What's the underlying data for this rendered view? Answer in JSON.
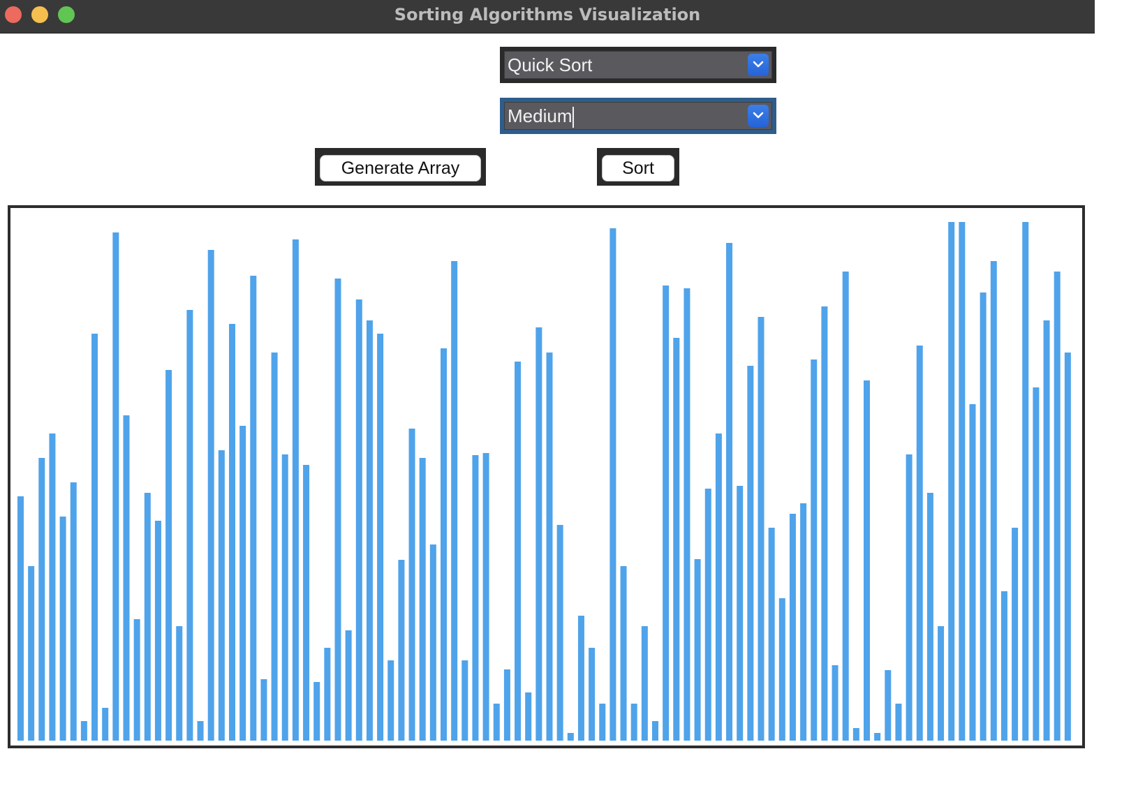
{
  "window": {
    "title": "Sorting Algorithms Visualization"
  },
  "controls": {
    "algorithm_select": {
      "value": "Quick Sort"
    },
    "speed_select": {
      "value": "Medium"
    },
    "generate_label": "Generate Array",
    "sort_label": "Sort"
  },
  "colors": {
    "bar": "#4fa3ea",
    "titlebar": "#3a3939",
    "select_button": "#2f6fe0"
  },
  "icons": [
    "close-icon",
    "minimize-icon",
    "zoom-icon",
    "chevron-down-icon"
  ],
  "chart_data": {
    "type": "bar",
    "description_values_are_relative_heights": true,
    "values": [
      350,
      250,
      405,
      440,
      321,
      370,
      28,
      583,
      47,
      728,
      466,
      174,
      355,
      315,
      531,
      164,
      617,
      28,
      703,
      416,
      597,
      451,
      666,
      88,
      556,
      410,
      718,
      395,
      84,
      133,
      662,
      158,
      632,
      602,
      583,
      115,
      259,
      447,
      405,
      281,
      562,
      687,
      115,
      409,
      412,
      53,
      102,
      543,
      69,
      592,
      556,
      309,
      11,
      179,
      133,
      53,
      734,
      250,
      53,
      164,
      28,
      652,
      577,
      648,
      260,
      361,
      440,
      713,
      365,
      537,
      607,
      305,
      204,
      325,
      340,
      546,
      622,
      108,
      672,
      18,
      516,
      11,
      101,
      53,
      410,
      566,
      355,
      164,
      743,
      743,
      482,
      642,
      687,
      214,
      305,
      743,
      506,
      602,
      672,
      556
    ]
  }
}
